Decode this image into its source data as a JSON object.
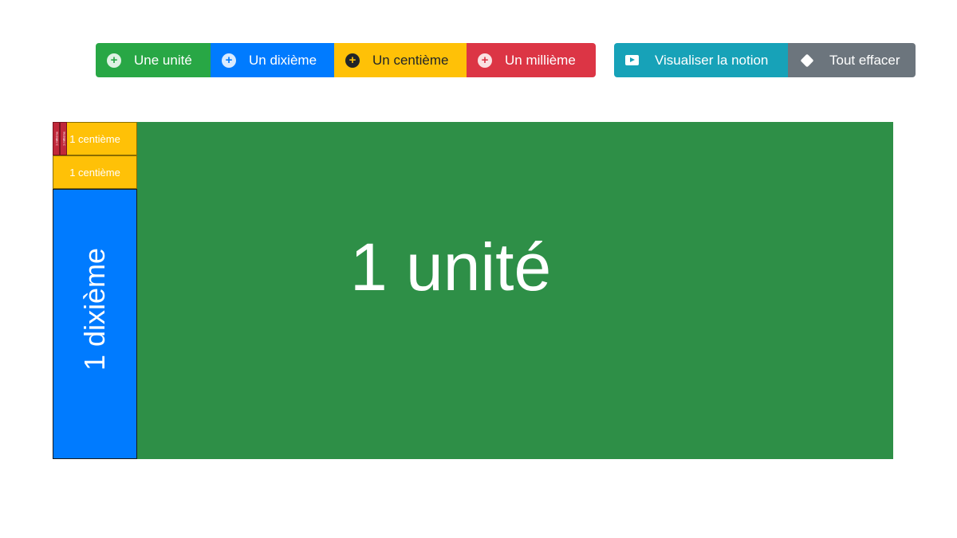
{
  "toolbar": {
    "add_buttons": [
      {
        "label": "Une unité",
        "icon": "plus-circle-icon",
        "color": "#28a745"
      },
      {
        "label": "Un dixième",
        "icon": "plus-circle-icon",
        "color": "#007bff"
      },
      {
        "label": "Un centième",
        "icon": "plus-circle-icon",
        "color": "#ffc107"
      },
      {
        "label": "Un millième",
        "icon": "plus-circle-icon",
        "color": "#dc3545"
      }
    ],
    "action_buttons": [
      {
        "label": "Visualiser la notion",
        "icon": "play-icon",
        "color": "#17a2b8"
      },
      {
        "label": "Tout effacer",
        "icon": "eraser-icon",
        "color": "#6c757d"
      }
    ]
  },
  "canvas": {
    "unit": {
      "label": "1 unité",
      "color": "#2e8f47"
    },
    "tenth": {
      "label": "1 dixième",
      "color": "#007bff"
    },
    "hundredths": [
      {
        "label": "1 centième",
        "color": "#ffc107"
      },
      {
        "label": "1 centième",
        "color": "#ffc107"
      }
    ],
    "thousandths": [
      {
        "label": "1 millième",
        "color": "#c0283a"
      },
      {
        "label": "1 millième",
        "color": "#c0283a"
      }
    ]
  }
}
